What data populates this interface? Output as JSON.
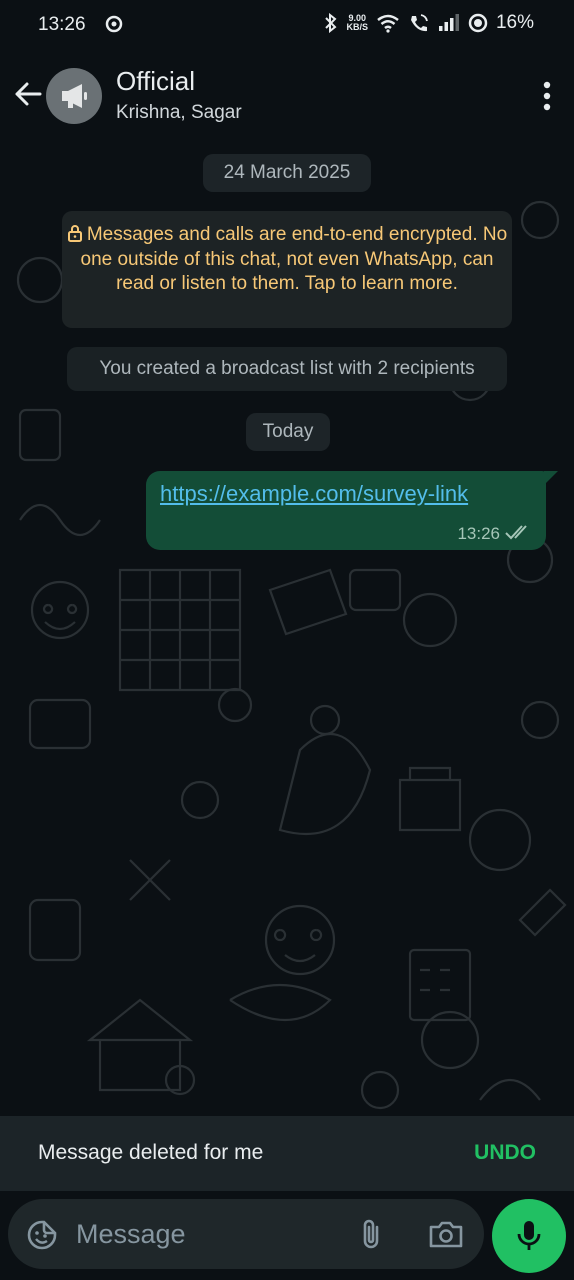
{
  "status_bar": {
    "time": "13:26",
    "speed_value": "9.00",
    "speed_unit": "KB/S",
    "battery": "16%"
  },
  "header": {
    "title": "Official",
    "subtitle": "Krishna, Sagar"
  },
  "chat": {
    "date_label": "24 March 2025",
    "encryption_notice": "Messages and calls are end-to-end encrypted. No one outside of this chat, not even WhatsApp, can read or listen to them. Tap to learn more.",
    "system_message": "You created a broadcast list with 2 recipients",
    "today_label": "Today",
    "messages": [
      {
        "text": "https://example.com/survey-link",
        "time": "13:26",
        "status": "read"
      }
    ]
  },
  "snackbar": {
    "text": "Message deleted for me",
    "action": "UNDO"
  },
  "composer": {
    "placeholder": "Message"
  },
  "colors": {
    "accent": "#21c063",
    "bubble_out": "#134d37",
    "link": "#53bdeb",
    "encryption_text": "#f7c877"
  }
}
